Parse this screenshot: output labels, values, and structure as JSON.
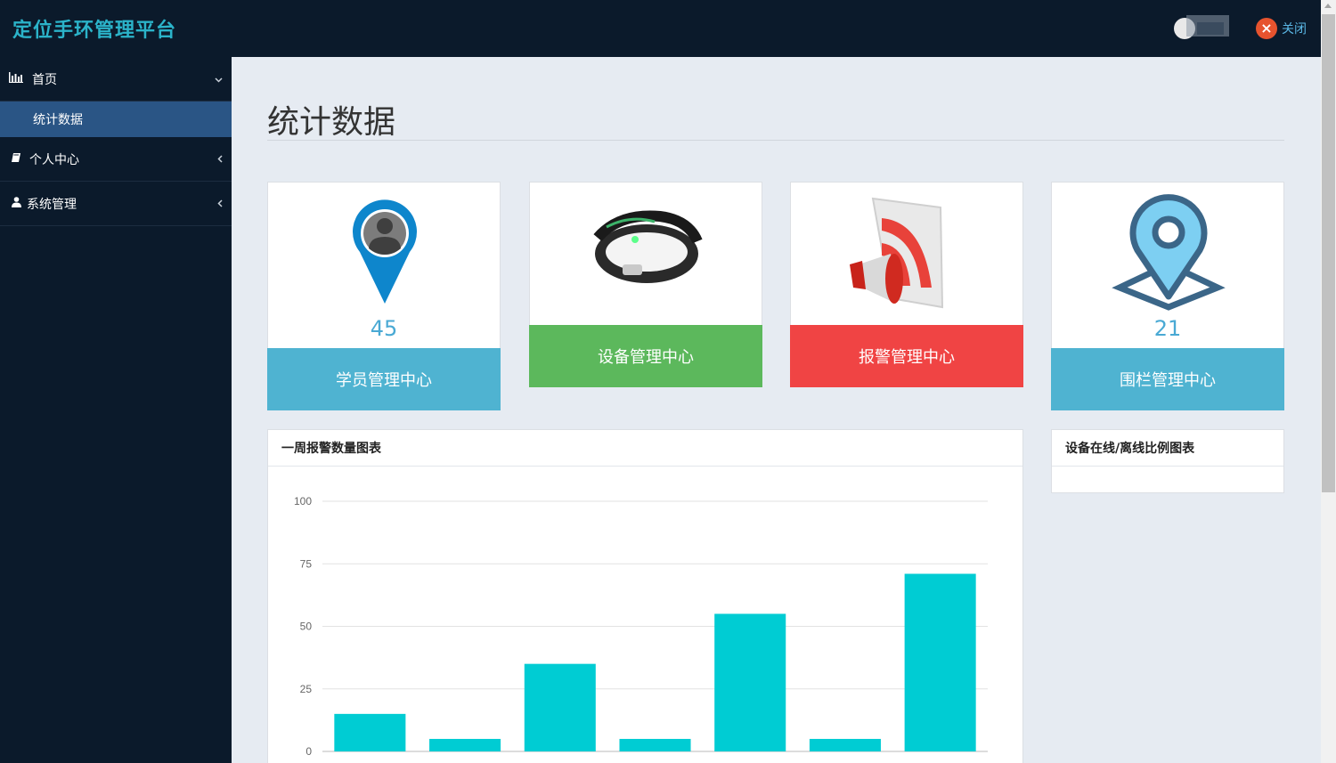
{
  "app": {
    "title": "定位手环管理平台",
    "close_label": "关闭"
  },
  "sidebar": {
    "items": [
      {
        "label": "首页",
        "icon": "bar-chart-icon",
        "expanded": true
      },
      {
        "label": "个人中心",
        "icon": "book-icon",
        "expanded": false
      },
      {
        "label": "系统管理",
        "icon": "user-icon",
        "expanded": false
      }
    ],
    "sub_items": [
      {
        "label": "统计数据",
        "active": true
      }
    ]
  },
  "page": {
    "title": "统计数据"
  },
  "cards": [
    {
      "label": "学员管理中心",
      "count": "45",
      "color": "#4fb3d1",
      "icon": "person-pin-icon"
    },
    {
      "label": "设备管理中心",
      "color": "#5cb85c",
      "icon": "wristband-icon"
    },
    {
      "label": "报警管理中心",
      "color": "#f04444",
      "icon": "megaphone-icon"
    },
    {
      "label": "围栏管理中心",
      "count": "21",
      "color": "#4fb3d1",
      "icon": "map-pin-icon"
    }
  ],
  "panels": {
    "weekly_alarm": {
      "title": "一周报警数量图表"
    },
    "online_ratio": {
      "title": "设备在线/离线比例图表"
    }
  },
  "chart_data": {
    "type": "bar",
    "categories": [
      "",
      "",
      "",
      "",
      "",
      "",
      ""
    ],
    "values": [
      15,
      5,
      35,
      5,
      55,
      5,
      71
    ],
    "y_ticks": [
      0,
      25,
      50,
      75,
      100
    ],
    "ylim": [
      0,
      100
    ],
    "grid": true,
    "bar_color": "#00ccd3"
  },
  "colors": {
    "sidebar_bg": "#0b1a2b",
    "active_sub": "#2a5585",
    "brand": "#2bb3c9"
  }
}
